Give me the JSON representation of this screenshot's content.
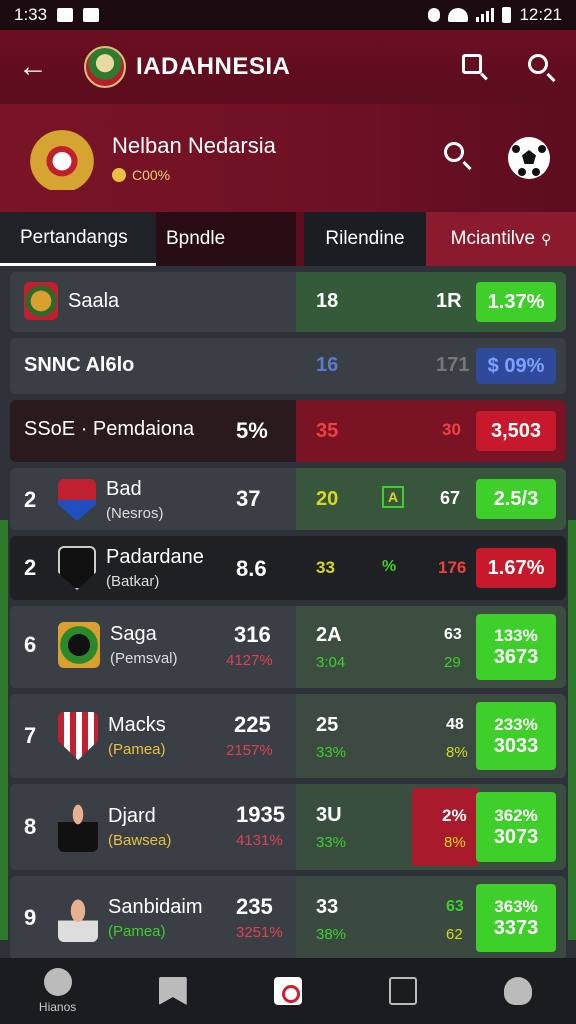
{
  "status_bar": {
    "time": "1:33",
    "clock": "12:21"
  },
  "app_bar": {
    "title": "IADAHNESIA",
    "icons": [
      "back-arrow",
      "search-icon",
      "search-icon"
    ]
  },
  "hero": {
    "title": "Nelban Nedarsia",
    "sub": "C00%"
  },
  "tabs": [
    {
      "label": "Pertandangs"
    },
    {
      "label": "Bpndle"
    },
    {
      "label": "Rilendine"
    },
    {
      "label": "Mciantilve",
      "icon": "⚲"
    }
  ],
  "rows": [
    {
      "name": "Saala",
      "m1": "18",
      "m2": "1R",
      "pct": "1.37%",
      "pct_color": "green"
    },
    {
      "name": "SNNC Al6lo",
      "m1": "16",
      "m2": "171",
      "pct": "$ 09%",
      "pct_color": "blue"
    },
    {
      "name": "SSoE · Pemdaiona",
      "val": "5%",
      "m1": "35",
      "m2": "30",
      "pct": "3,503",
      "pct_color": "red"
    },
    {
      "rank": "2",
      "name": "Bad",
      "sub": "(Nesros)",
      "val": "37",
      "m1": "20",
      "m_icon": "A",
      "m2": "67",
      "pct": "2.5/3",
      "pct_color": "green"
    },
    {
      "rank": "2",
      "name": "Padardane",
      "sub": "(Batkar)",
      "val": "8.6",
      "m1": "33",
      "m_pct": "%",
      "m2": "176",
      "pct": "1.67%",
      "pct_color": "red"
    },
    {
      "rank": "6",
      "name": "Saga",
      "sub": "(Pemsval)",
      "val": "316",
      "val_sub": "4127%",
      "m1": "2A",
      "m1_sub": "3:04",
      "m2": "63",
      "m2_sub": "29",
      "pct": "133%",
      "pct2": "3673",
      "pct_color": "green"
    },
    {
      "rank": "7",
      "name": "Macks",
      "sub": "(Pamea)",
      "val": "225",
      "val_sub": "2157%",
      "m1": "25",
      "m1_sub": "33%",
      "m2": "48",
      "m2_sub": "8%",
      "pct": "233%",
      "pct2": "3033",
      "pct_color": "green"
    },
    {
      "rank": "8",
      "name": "Djard",
      "sub": "(Bawsea)",
      "val": "1935",
      "val_sub": "4131%",
      "m1": "3U",
      "m1_sub": "33%",
      "m2": "2%",
      "m2_sub": "8%",
      "pct": "362%",
      "pct2": "3073",
      "pct_color": "green"
    },
    {
      "rank": "9",
      "name": "Sanbidaim",
      "sub": "(Pamea)",
      "val": "235",
      "val_sub": "3251%",
      "m1": "33",
      "m1_sub": "38%",
      "m2": "63",
      "m2_sub": "62",
      "pct": "363%",
      "pct2": "3373",
      "pct_color": "green"
    }
  ],
  "bottom_nav": [
    {
      "label": "Hianos",
      "icon": "home-icon"
    },
    {
      "label": "",
      "icon": "bookmark-icon"
    },
    {
      "label": "",
      "icon": "live-icon"
    },
    {
      "label": "",
      "icon": "download-icon"
    },
    {
      "label": "",
      "icon": "shield-icon"
    }
  ],
  "colors": {
    "primary": "#6b0f22",
    "green": "#3ecf2a",
    "red": "#c8192c",
    "row": "#3a3f46"
  }
}
